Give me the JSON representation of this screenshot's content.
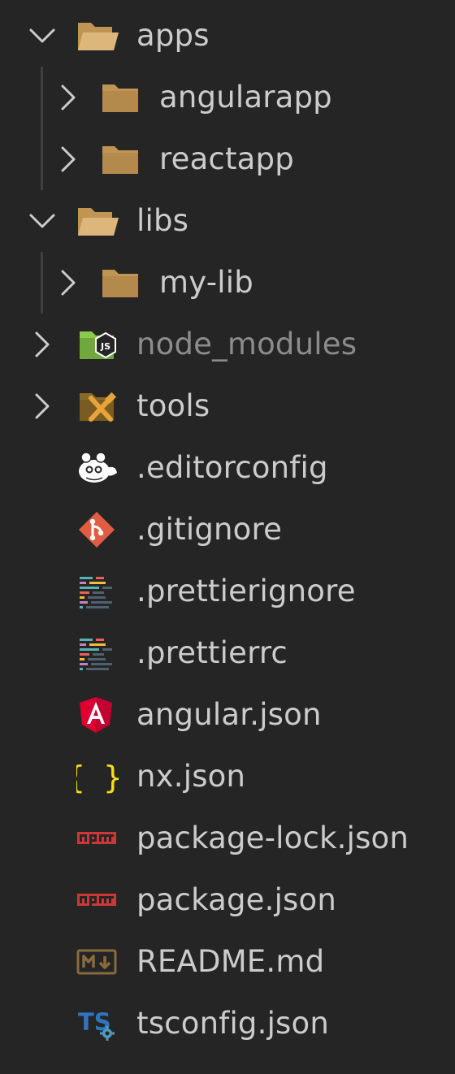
{
  "explorer": {
    "items": [
      {
        "label": "apps",
        "kind": "folder",
        "expanded": true,
        "depth": 0,
        "icon": "folder-open-icon"
      },
      {
        "label": "angularapp",
        "kind": "folder",
        "expanded": false,
        "depth": 1,
        "icon": "folder-icon"
      },
      {
        "label": "reactapp",
        "kind": "folder",
        "expanded": false,
        "depth": 1,
        "icon": "folder-icon"
      },
      {
        "label": "libs",
        "kind": "folder",
        "expanded": true,
        "depth": 0,
        "icon": "folder-open-icon"
      },
      {
        "label": "my-lib",
        "kind": "folder",
        "expanded": false,
        "depth": 1,
        "icon": "folder-icon"
      },
      {
        "label": "node_modules",
        "kind": "folder",
        "expanded": false,
        "depth": 0,
        "icon": "nodejs-folder-icon",
        "dimmed": true
      },
      {
        "label": "tools",
        "kind": "folder",
        "expanded": false,
        "depth": 0,
        "icon": "tools-folder-icon"
      },
      {
        "label": ".editorconfig",
        "kind": "file",
        "depth": 0,
        "icon": "editorconfig-icon"
      },
      {
        "label": ".gitignore",
        "kind": "file",
        "depth": 0,
        "icon": "git-icon"
      },
      {
        "label": ".prettierignore",
        "kind": "file",
        "depth": 0,
        "icon": "prettier-icon"
      },
      {
        "label": ".prettierrc",
        "kind": "file",
        "depth": 0,
        "icon": "prettier-icon"
      },
      {
        "label": "angular.json",
        "kind": "file",
        "depth": 0,
        "icon": "angular-icon"
      },
      {
        "label": "nx.json",
        "kind": "file",
        "depth": 0,
        "icon": "json-braces-icon"
      },
      {
        "label": "package-lock.json",
        "kind": "file",
        "depth": 0,
        "icon": "npm-icon"
      },
      {
        "label": "package.json",
        "kind": "file",
        "depth": 0,
        "icon": "npm-icon"
      },
      {
        "label": "README.md",
        "kind": "file",
        "depth": 0,
        "icon": "markdown-icon"
      },
      {
        "label": "tsconfig.json",
        "kind": "file",
        "depth": 0,
        "icon": "typescript-config-icon"
      }
    ]
  },
  "colors": {
    "background": "#252526",
    "text": "#cccccc",
    "dimmed_text": "#8c8c8c",
    "folder": "#c09553",
    "folder_open": "#dcb67a",
    "git": "#e05d44",
    "angular": "#dd0031",
    "json_braces": "#f5de19",
    "npm": "#cb3837",
    "typescript": "#2f74c0",
    "nodejs": "#8cc84b"
  }
}
